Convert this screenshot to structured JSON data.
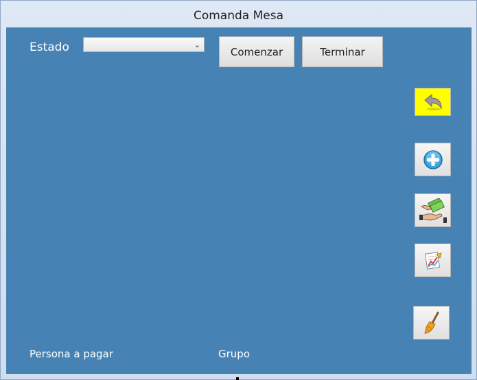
{
  "window": {
    "title": "Comanda Mesa"
  },
  "form": {
    "estado_label": "Estado",
    "estado_value": "",
    "comenzar_label": "Comenzar",
    "terminar_label": "Terminar",
    "persona_label": "Persona a pagar",
    "grupo_label": "Grupo"
  },
  "side_buttons": [
    {
      "icon": "back-arrow-icon",
      "accent": "#ffff00"
    },
    {
      "icon": "add-circle-icon",
      "accent": "#2e9ad6"
    },
    {
      "icon": "payment-hand-icon",
      "accent": "#4caf50"
    },
    {
      "icon": "report-chart-icon",
      "accent": "#e05050"
    },
    {
      "icon": "broom-icon",
      "accent": "#e8a020"
    }
  ]
}
